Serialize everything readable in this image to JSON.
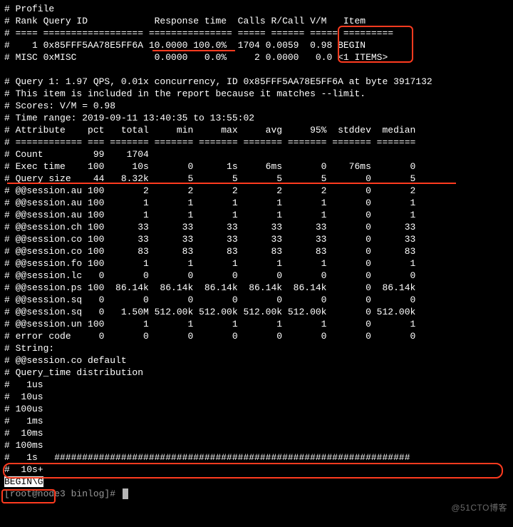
{
  "profile": {
    "title": "# Profile",
    "header": "# Rank Query ID            Response time  Calls R/Call V/M   Item",
    "sep1": "# ==== ================== =============== ===== ====== ===== =========",
    "row1": "#    1 0x85FFF5AA78E5FF6A 10.0000 100.0%  1704 0.0059  0.98 BEGIN",
    "row2": "# MISC 0xMISC              0.0000   0.0%     2 0.0000   0.0 <1 ITEMS>"
  },
  "query": {
    "title": "# Query 1: 1.97 QPS, 0.01x concurrency, ID 0x85FFF5AA78E5FF6A at byte 3917132",
    "note": "# This item is included in the report because it matches --limit.",
    "scores": "# Scores: V/M = 0.98",
    "range": "# Time range: 2019-09-11 13:40:35 to 13:55:02",
    "hdr": "# Attribute    pct   total     min     max     avg     95%  stddev  median",
    "sep": "# ============ === ======= ======= ======= ======= ======= ======= =======",
    "rows": [
      "# Count         99    1704",
      "# Exec time    100     10s       0      1s     6ms       0    76ms       0",
      "# Query size    44   8.32k       5       5       5       5       0       5",
      "# @@session.au 100       2       2       2       2       2       0       2",
      "# @@session.au 100       1       1       1       1       1       0       1",
      "# @@session.au 100       1       1       1       1       1       0       1",
      "# @@session.ch 100      33      33      33      33      33       0      33",
      "# @@session.co 100      33      33      33      33      33       0      33",
      "# @@session.co 100      83      83      83      83      83       0      83",
      "# @@session.fo 100       1       1       1       1       1       0       1",
      "# @@session.lc   0       0       0       0       0       0       0       0",
      "# @@session.ps 100  86.14k  86.14k  86.14k  86.14k  86.14k       0  86.14k",
      "# @@session.sq   0       0       0       0       0       0       0       0",
      "# @@session.sq   0   1.50M 512.00k 512.00k 512.00k 512.00k       0 512.00k",
      "# @@session.un 100       1       1       1       1       1       0       1",
      "# error code     0       0       0       0       0       0       0       0"
    ],
    "string": "# String:",
    "sessco": "# @@session.co default",
    "dist": "# Query_time distribution",
    "bins": [
      "#   1us",
      "#  10us",
      "# 100us",
      "#   1ms",
      "#  10ms",
      "# 100ms",
      "#   1s   ################################################################",
      "#  10s+"
    ]
  },
  "footer": {
    "begin": "BEGIN\\G",
    "prompt": "[root@node3 binlog]# "
  },
  "watermark": "@51CTO博客"
}
